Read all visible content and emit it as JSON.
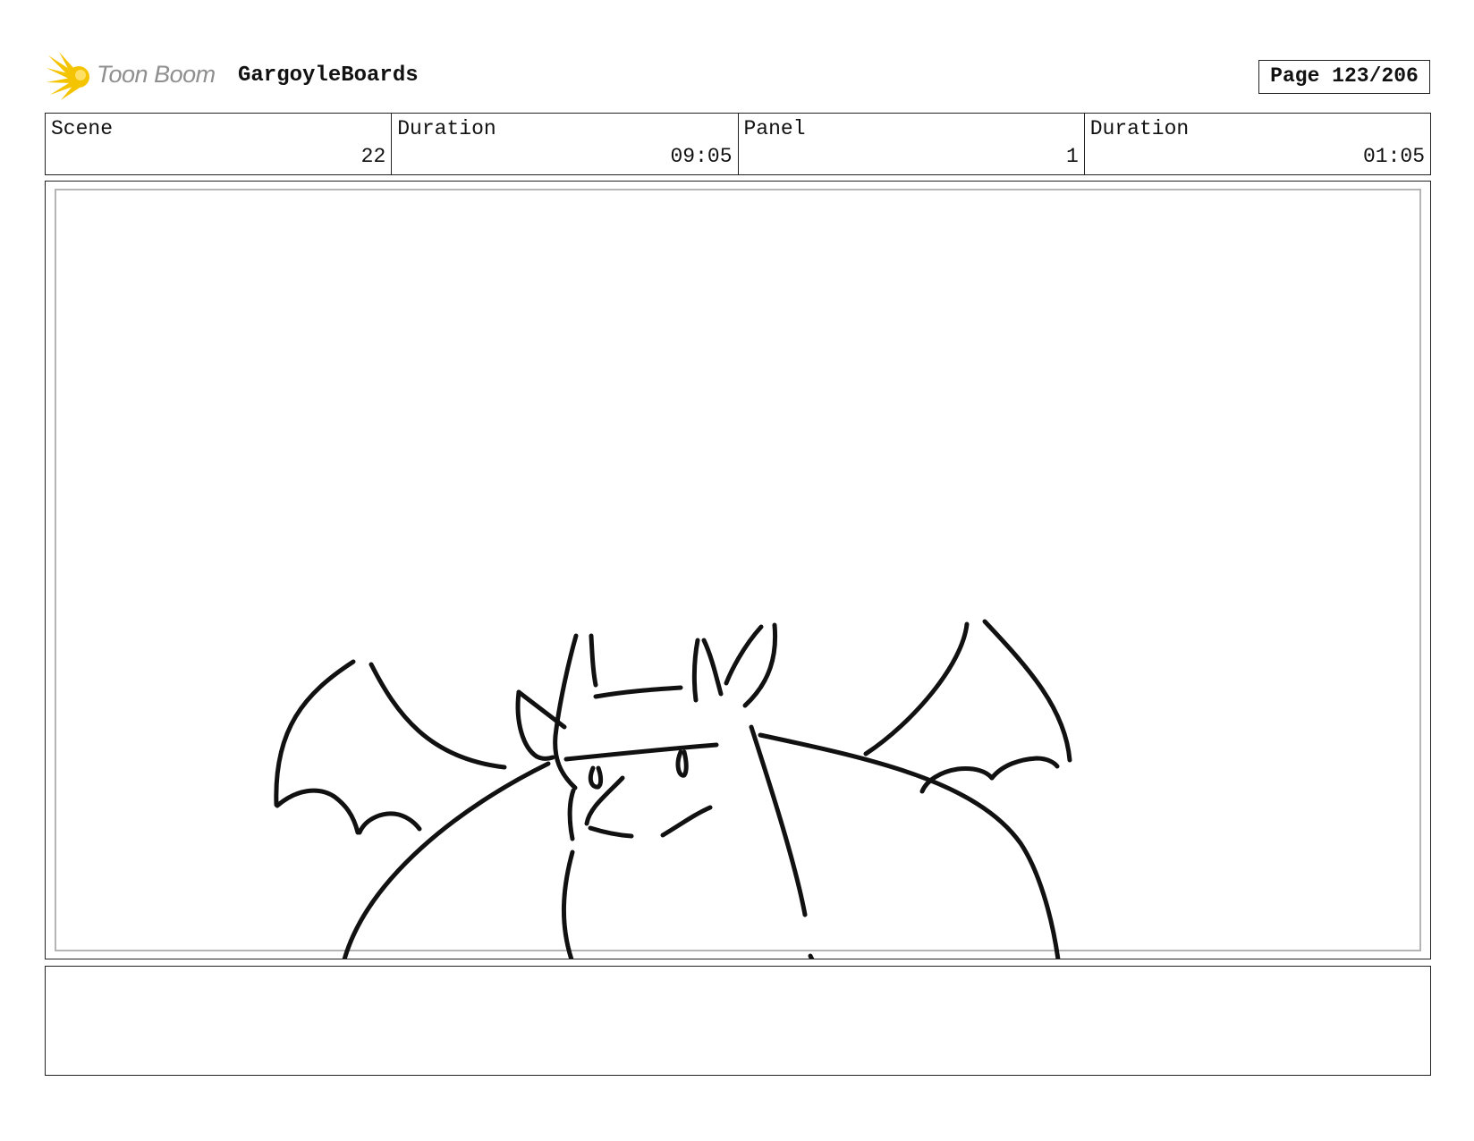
{
  "header": {
    "logo_text": "Toon Boom",
    "logo_icon": "toon-boom-starburst-icon",
    "project_title": "GargoyleBoards",
    "page_label": "Page 123/206"
  },
  "info": {
    "scene_label": "Scene",
    "scene_value": "22",
    "scene_duration_label": "Duration",
    "scene_duration_value": "09:05",
    "panel_label": "Panel",
    "panel_value": "1",
    "panel_duration_label": "Duration",
    "panel_duration_value": "01:05"
  },
  "panel": {
    "image_subject": "gargoyle-sketch"
  },
  "notes": {
    "text": ""
  },
  "colors": {
    "logo_sun_yellow": "#f5c400",
    "logo_text_gray": "#8f8f8f",
    "border": "#222222",
    "panel_inner_border": "#b5b5b5",
    "sketch_stroke": "#111111"
  }
}
